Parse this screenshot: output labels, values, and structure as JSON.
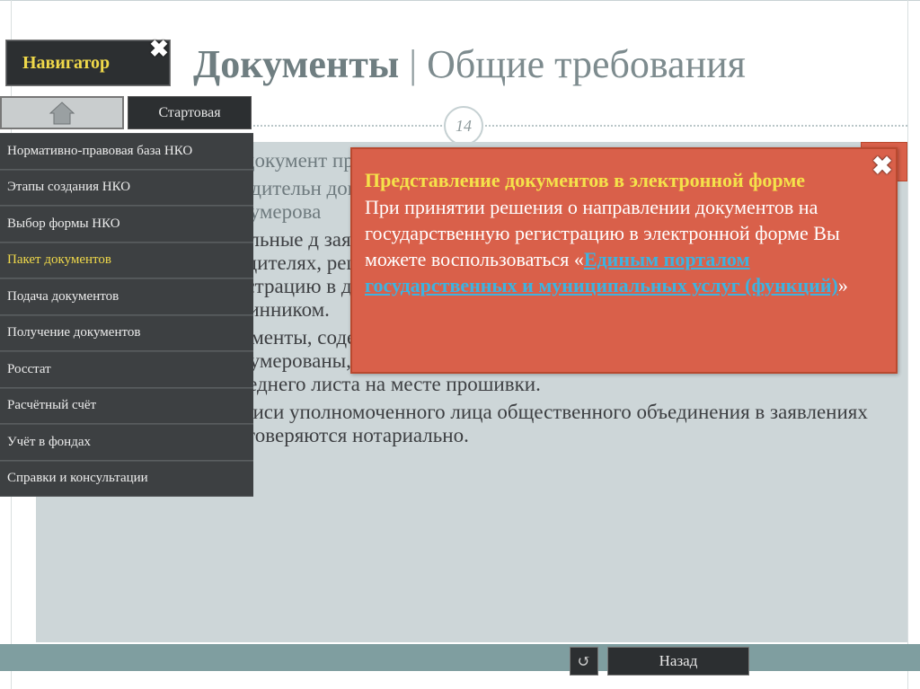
{
  "slide": {
    "title_bold": "Документы",
    "title_sep": " | ",
    "title_rest": "Общие требования",
    "number": "14"
  },
  "navigator": {
    "label": "Навигатор",
    "close_icon": "close-icon",
    "home_icon": "home-icon",
    "start_label": "Стартовая",
    "items": [
      {
        "label": "Нормативно-правовая база НКО",
        "active": false
      },
      {
        "label": "Этапы создания НКО",
        "active": false
      },
      {
        "label": "Выбор формы НКО",
        "active": false
      },
      {
        "label": "Пакет документов",
        "active": true
      },
      {
        "label": "Подача документов",
        "active": false
      },
      {
        "label": "Получение документов",
        "active": false
      },
      {
        "label": "Росстат",
        "active": false
      },
      {
        "label": "Расчётный счёт",
        "active": false
      },
      {
        "label": "Учёт в фондах",
        "active": false
      },
      {
        "label": "Справки и консультации",
        "active": false
      }
    ]
  },
  "content": {
    "bullets": [
      "Все документ представляю",
      "Учредительн договор) пре два из котор подписью за экземпляров пронумерова",
      "Остальные д заявление о государственной регистрации, сведения об учредителях, решение о создании) представляются на государственную регистрацию в двух экземплярах, один из которых должен быть подлинником.",
      "Документы, содержащие более одного листа, должны быть пронумерованы, прошиты и заверены подписью заявителя на обороте последнего листа на месте прошивки.",
      "Подписи уполномоченного лица общественного объединения в заявлениях удостоверяются нотариально."
    ]
  },
  "popup": {
    "heading": "Представление документов в электронной форме",
    "body_before": "При принятии решения о направлении документов на государственную регистрацию в электронной форме Вы можете воспользоваться «",
    "link_text": "Единым порталом государственных и муниципальных услуг (функций)",
    "body_after": "»",
    "close_icon": "close-icon"
  },
  "footer": {
    "back_icon": "undo-icon",
    "back_label": "Назад"
  },
  "colors": {
    "popup_bg": "#d9604a",
    "nav_dark": "#2c2f31",
    "active_text": "#f0d94a",
    "link": "#3db3e0",
    "content_bg": "#cdd6d8",
    "strip": "#7f9ea0",
    "bullet": "#e06a50"
  }
}
